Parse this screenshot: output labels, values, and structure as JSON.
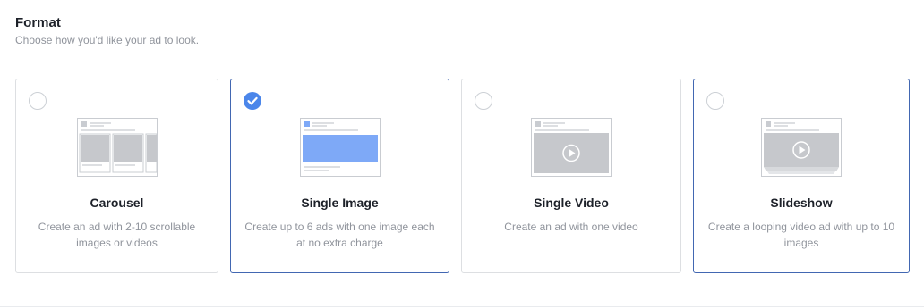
{
  "format": {
    "title": "Format",
    "subtitle": "Choose how you'd like your ad to look."
  },
  "options": [
    {
      "title": "Carousel",
      "description": "Create an ad with 2-10 scrollable images or videos",
      "selected": false,
      "icon": "carousel-illustration"
    },
    {
      "title": "Single Image",
      "description": "Create up to 6 ads with one image each at no extra charge",
      "selected": true,
      "icon": "single-image-illustration"
    },
    {
      "title": "Single Video",
      "description": "Create an ad with one video",
      "selected": false,
      "icon": "single-video-illustration"
    },
    {
      "title": "Slideshow",
      "description": "Create a looping video ad with up to 10 images",
      "selected": false,
      "icon": "slideshow-illustration"
    }
  ],
  "colors": {
    "accent": "#4267b2",
    "check": "#4b86ea",
    "image_blue": "#7ea9f7",
    "placeholder_gray": "#c6c8cc"
  }
}
